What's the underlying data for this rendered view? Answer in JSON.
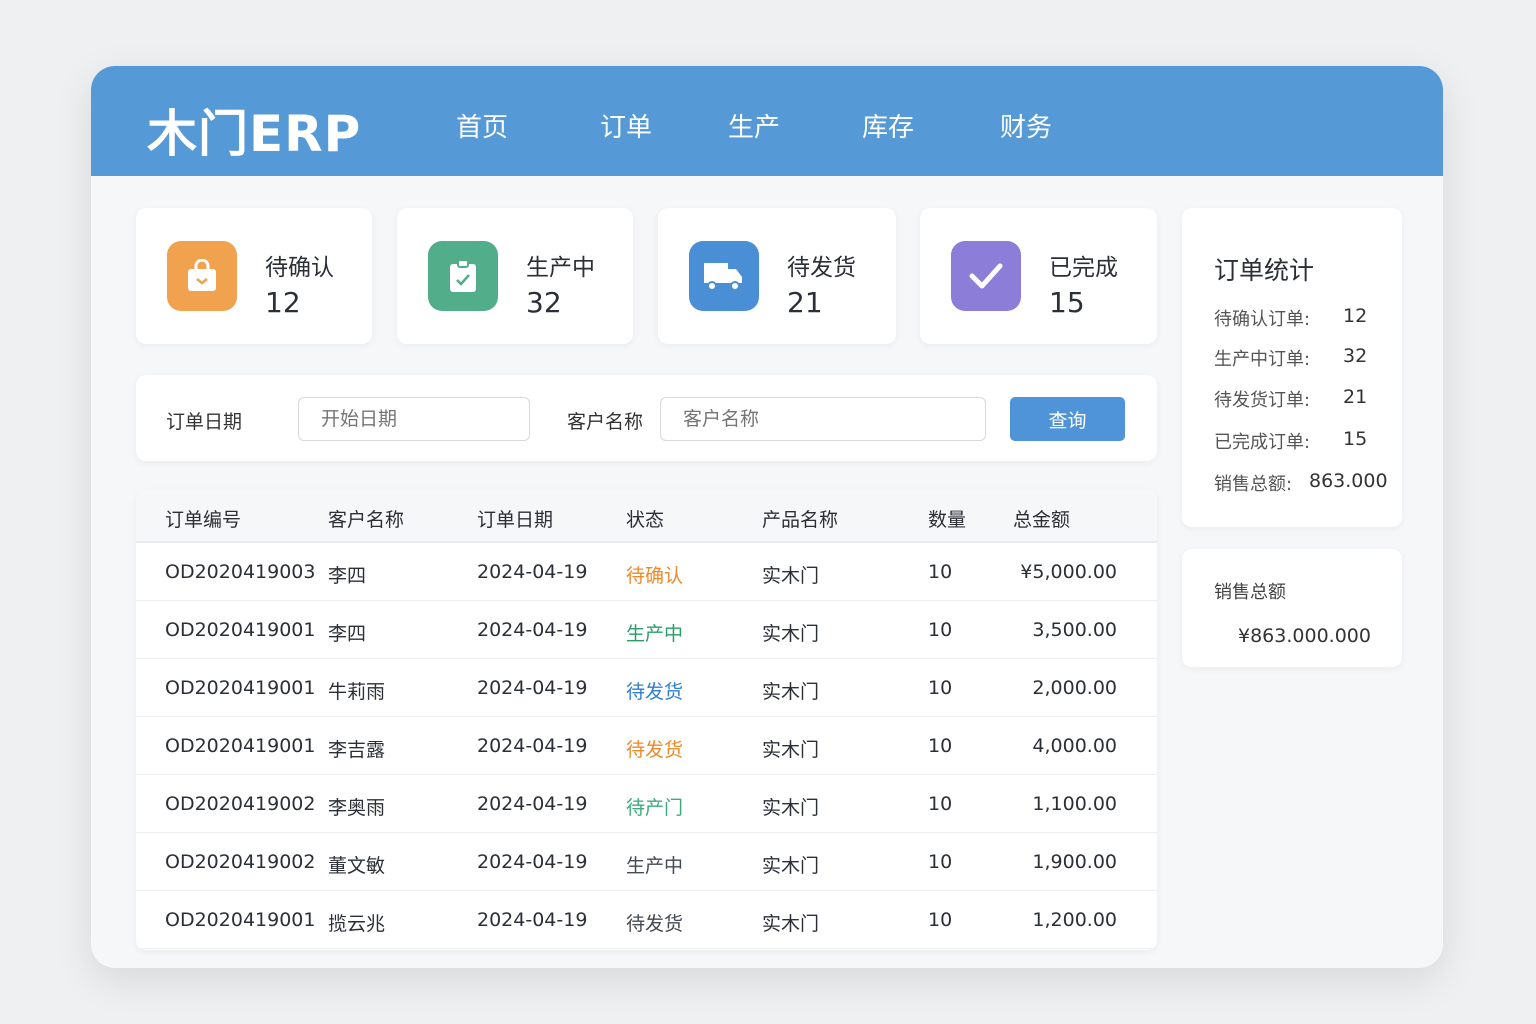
{
  "header": {
    "logo": "木门ERP",
    "nav": [
      "首页",
      "订单",
      "生产",
      "库存",
      "财务"
    ]
  },
  "stats": [
    {
      "label": "待确认",
      "value": "12",
      "color": "#f0a24e",
      "icon": "shopping-bag-icon"
    },
    {
      "label": "生产中",
      "value": "32",
      "color": "#52ad8a",
      "icon": "clipboard-check-icon"
    },
    {
      "label": "待发货",
      "value": "21",
      "color": "#4a8fd6",
      "icon": "truck-icon"
    },
    {
      "label": "已完成",
      "value": "15",
      "color": "#8c7ed8",
      "icon": "check-icon"
    }
  ],
  "filter": {
    "date_label": "订单日期",
    "date_placeholder": "开始日期",
    "customer_label": "客户名称",
    "customer_placeholder": "客户名称",
    "search_button": "查询"
  },
  "table": {
    "headers": [
      "订单编号",
      "客户名称",
      "订单日期",
      "状态",
      "产品名称",
      "数量",
      "总金额"
    ],
    "rows": [
      {
        "id": "OD2020419003",
        "customer": "李四",
        "date": "2024-04-19",
        "status": "待确认",
        "status_color": "#ec8a2b",
        "product": "实木门",
        "qty": "10",
        "amount": "¥5,000.00"
      },
      {
        "id": "OD2020419001",
        "customer": "李四",
        "date": "2024-04-19",
        "status": "生产中",
        "status_color": "#2c9c6a",
        "product": "实木门",
        "qty": "10",
        "amount": "3,500.00"
      },
      {
        "id": "OD2020419001",
        "customer": "牛莉雨",
        "date": "2024-04-19",
        "status": "待发货",
        "status_color": "#2f7fd0",
        "product": "实木门",
        "qty": "10",
        "amount": "2,000.00"
      },
      {
        "id": "OD2020419001",
        "customer": "李吉露",
        "date": "2024-04-19",
        "status": "待发货",
        "status_color": "#ec8a2b",
        "product": "实木门",
        "qty": "10",
        "amount": "4,000.00"
      },
      {
        "id": "OD2020419002",
        "customer": "李奥雨",
        "date": "2024-04-19",
        "status": "待产门",
        "status_color": "#3daa7c",
        "product": "实木门",
        "qty": "10",
        "amount": "1,100.00"
      },
      {
        "id": "OD2020419002",
        "customer": "董文敏",
        "date": "2024-04-19",
        "status": "生产中",
        "status_color": "#444a52",
        "product": "实木门",
        "qty": "10",
        "amount": "1,900.00"
      },
      {
        "id": "OD2020419001",
        "customer": "揽云兆",
        "date": "2024-04-19",
        "status": "待发货",
        "status_color": "#444a52",
        "product": "实木门",
        "qty": "10",
        "amount": "1,200.00"
      }
    ]
  },
  "summary": {
    "title": "订单统计",
    "items": [
      {
        "label": "待确认订单:",
        "value": "12"
      },
      {
        "label": "生产中订单:",
        "value": "32"
      },
      {
        "label": "待发货订单:",
        "value": "21"
      },
      {
        "label": "已完成订单:",
        "value": "15"
      }
    ],
    "sales_label": "销售总额:",
    "sales_value": "863.000"
  },
  "sales_card": {
    "label": "销售总额",
    "value": "¥863.000.000"
  }
}
